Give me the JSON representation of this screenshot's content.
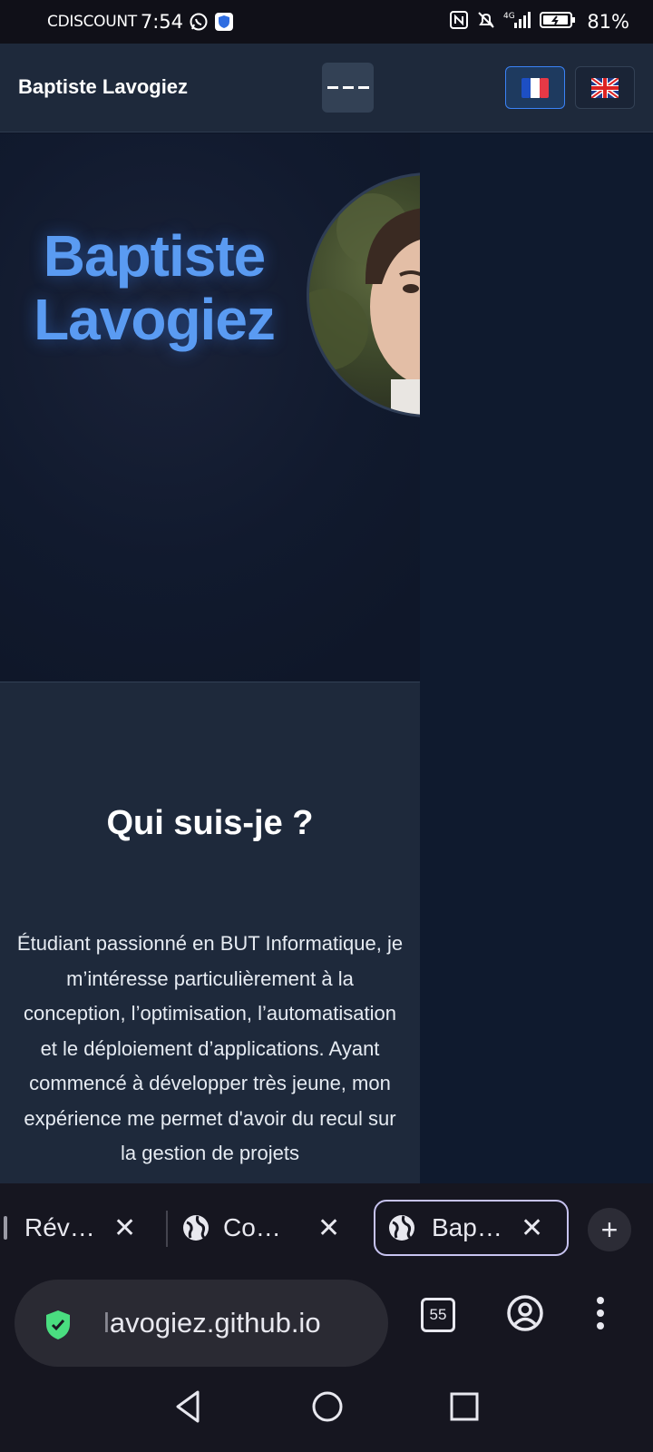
{
  "status_bar": {
    "carrier": "CDISCOUNT",
    "time": "7:54",
    "network": "4G",
    "battery": "81%"
  },
  "site": {
    "brand": "Baptiste Lavogiez",
    "languages": [
      {
        "code": "fr",
        "flag": "🇫🇷",
        "active": true
      },
      {
        "code": "en",
        "flag": "🇬🇧",
        "active": false
      }
    ],
    "hero": {
      "name_line1": "Baptiste",
      "name_line2": "Lavogiez"
    },
    "about": {
      "title": "Qui suis-je ?",
      "text": "Étudiant passionné en BUT Informatique, je m’intéresse particulièrement à la conception, l’optimisation, l’automatisation et le déploiement d’applications. Ayant commencé à développer très jeune, mon expérience me permet d'avoir du recul sur la gestion de projets"
    }
  },
  "browser": {
    "tabs": [
      {
        "title": "Rév…",
        "active": false
      },
      {
        "title": "Co…",
        "active": false
      },
      {
        "title": "Bap…",
        "active": true
      }
    ],
    "url_prefix": "l",
    "url_rest": "avogiez.github.io",
    "tab_count": "55"
  },
  "colors": {
    "accent": "#5a9bf2",
    "nav_bg": "#1e293b",
    "hero_bg": "#111a2e",
    "secure_green": "#4ade80"
  }
}
